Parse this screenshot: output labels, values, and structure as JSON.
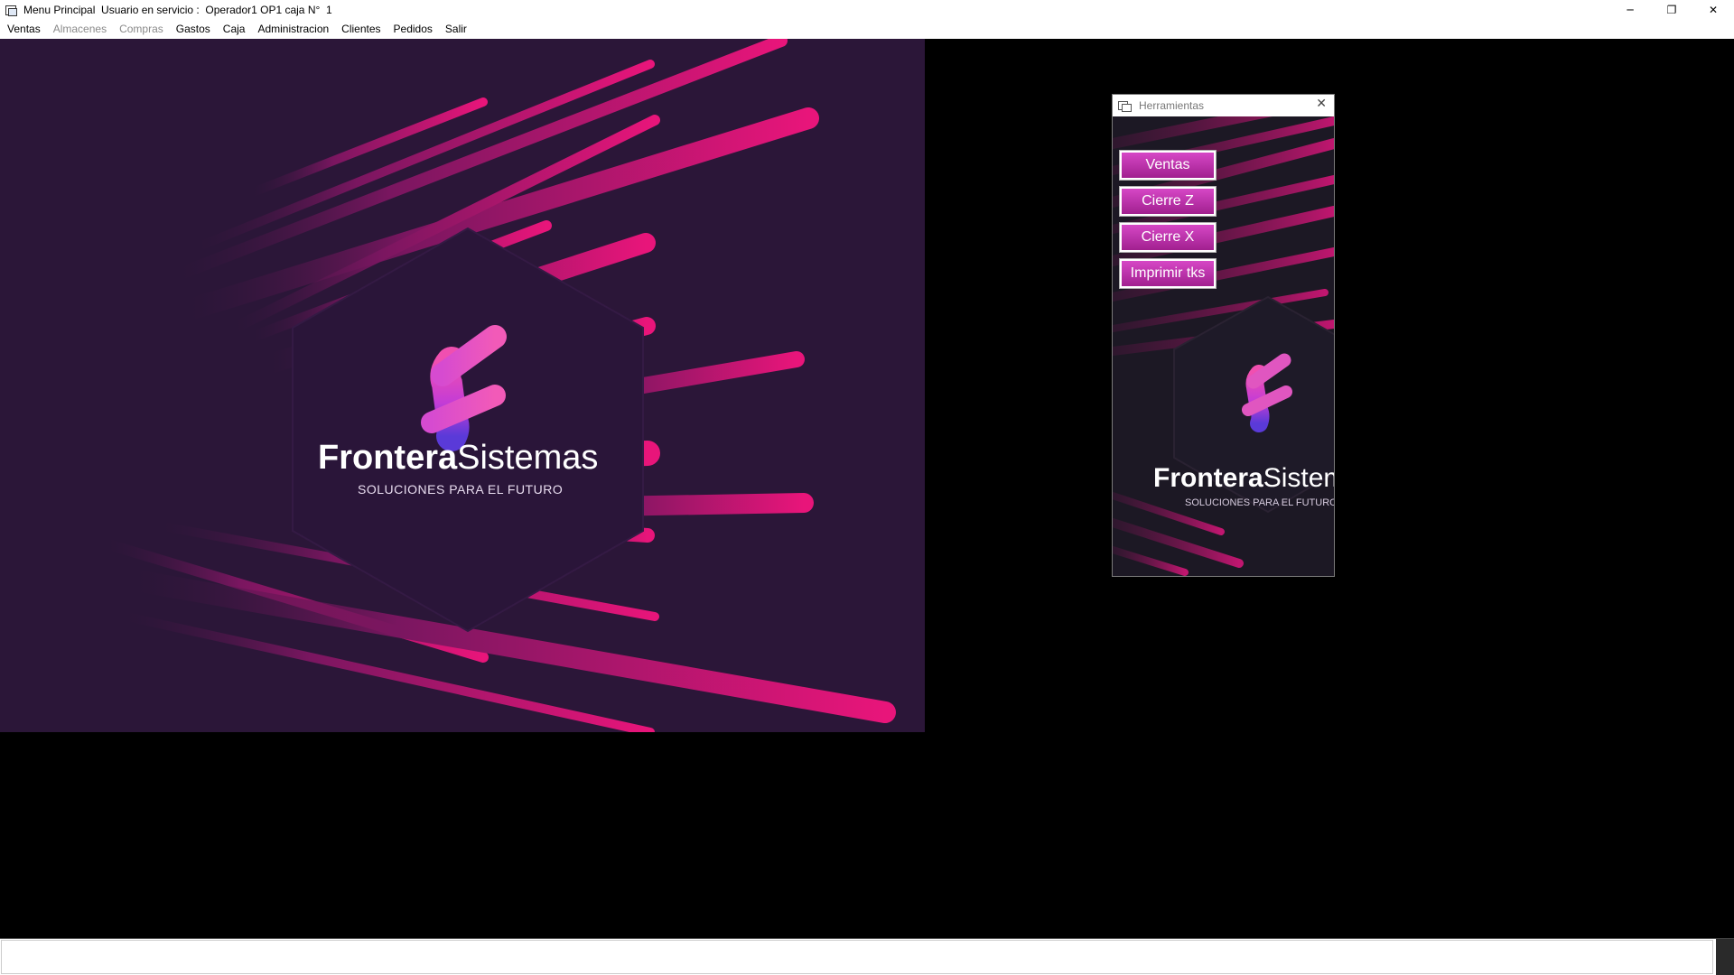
{
  "window": {
    "title": "Menu Principal  Usuario en servicio :  Operador1 OP1 caja N°  1",
    "controls": {
      "minimize": "─",
      "restore": "❐",
      "close": "✕"
    }
  },
  "menu": [
    {
      "label": "Ventas",
      "enabled": true
    },
    {
      "label": "Almacenes",
      "enabled": false
    },
    {
      "label": "Compras",
      "enabled": false
    },
    {
      "label": "Gastos",
      "enabled": true
    },
    {
      "label": "Caja",
      "enabled": true
    },
    {
      "label": "Administracion",
      "enabled": true
    },
    {
      "label": "Clientes",
      "enabled": true
    },
    {
      "label": "Pedidos",
      "enabled": true
    },
    {
      "label": "Salir",
      "enabled": true
    }
  ],
  "banner": {
    "brand_bold": "Frontera",
    "brand_light": "Sistemas",
    "tagline": "SOLUCIONES PARA EL FUTURO"
  },
  "tools_window": {
    "title": "Herramientas",
    "close_glyph": "✕",
    "buttons": [
      "Ventas",
      "Cierre Z",
      "Cierre X",
      "Imprimir tks"
    ],
    "brand_bold": "Frontera",
    "brand_light": "Sistemas",
    "tagline": "SOLUCIONES PARA EL FUTURO"
  },
  "colors": {
    "banner_bg": "#2b1638",
    "stripe_pink": "#e0157a",
    "button_gradient_top": "#d647c6",
    "button_gradient_bottom": "#a1208f"
  }
}
